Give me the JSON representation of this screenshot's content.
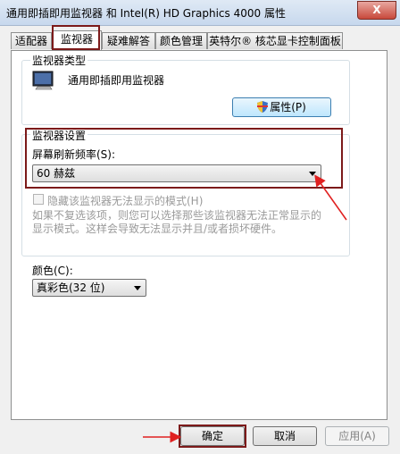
{
  "window": {
    "title": "通用即插即用监视器 和 Intel(R) HD Graphics 4000 属性",
    "close_label": "X"
  },
  "tabs": [
    {
      "label": "适配器"
    },
    {
      "label": "监视器"
    },
    {
      "label": "疑难解答"
    },
    {
      "label": "颜色管理"
    },
    {
      "label": "英特尔® 核芯显卡控制面板"
    }
  ],
  "monitor_type": {
    "group_label": "监视器类型",
    "name": "通用即插即用监视器",
    "properties_button": "属性(P)"
  },
  "monitor_settings": {
    "group_label": "监视器设置",
    "refresh_label": "屏幕刷新频率(S):",
    "refresh_value": "60 赫兹",
    "hide_modes_label": "隐藏该监视器无法显示的模式(H)",
    "hint_text": "如果不复选该项，则您可以选择那些该监视器无法正常显示的显示模式。这样会导致无法显示并且/或者损坏硬件。"
  },
  "color": {
    "label": "颜色(C):",
    "value": "真彩色(32 位)"
  },
  "buttons": {
    "ok": "确定",
    "cancel": "取消",
    "apply": "应用(A)"
  },
  "colors": {
    "annotation": "#7c1a1a",
    "arrow": "#e02020"
  }
}
